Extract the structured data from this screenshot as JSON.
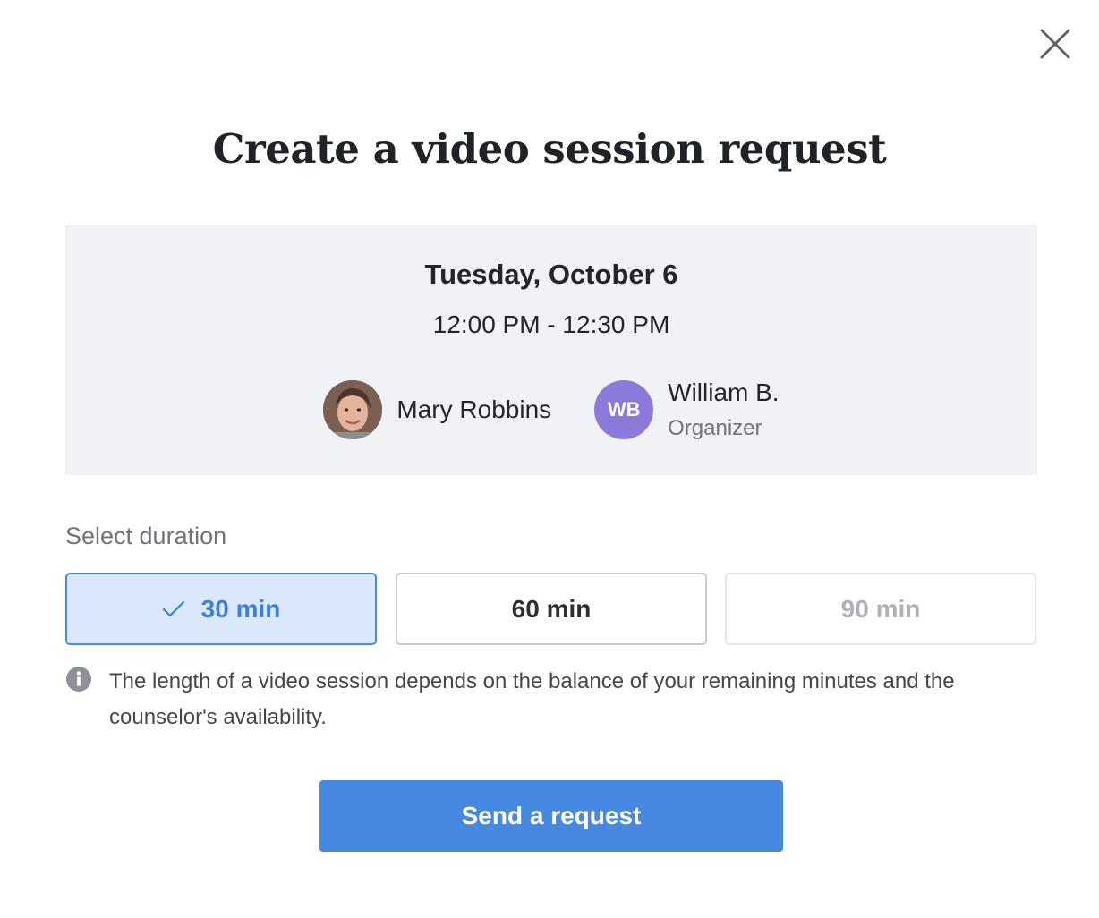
{
  "modal": {
    "title": "Create a video session request",
    "close_icon": "close-icon"
  },
  "session": {
    "date": "Tuesday, October 6",
    "time": "12:00 PM - 12:30 PM",
    "participants": [
      {
        "name": "Mary Robbins",
        "avatar": "photo"
      },
      {
        "name": "William B.",
        "initials": "WB",
        "role": "Organizer",
        "avatar_color": "#8b7ad9"
      }
    ]
  },
  "duration": {
    "label": "Select duration",
    "options": [
      {
        "label": "30 min",
        "state": "selected"
      },
      {
        "label": "60 min",
        "state": "available"
      },
      {
        "label": "90 min",
        "state": "disabled"
      }
    ]
  },
  "info": {
    "icon": "info-icon",
    "text": "The length of a video session depends on the balance of your remaining minutes and the counselor's availability."
  },
  "actions": {
    "send_label": "Send a request"
  },
  "colors": {
    "accent": "#4589e2",
    "selected_bg": "#d9e8fb",
    "summary_bg": "#f1f2f5"
  }
}
